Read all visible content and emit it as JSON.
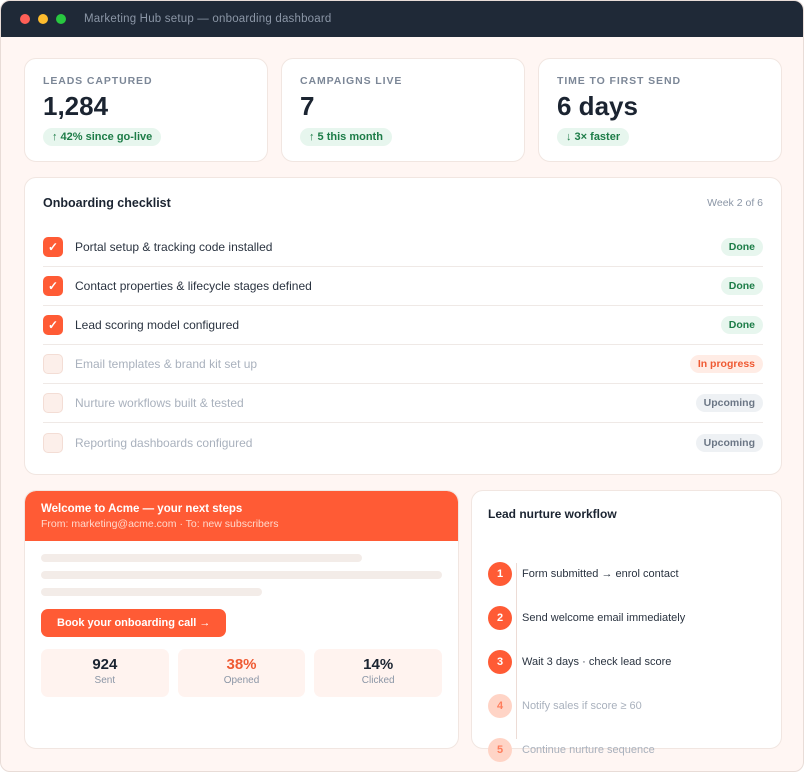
{
  "window": {
    "title": "Marketing Hub setup — onboarding dashboard"
  },
  "stats": [
    {
      "label": "LEADS CAPTURED",
      "value": "1,284",
      "delta": "↑ 42% since go-live"
    },
    {
      "label": "CAMPAIGNS LIVE",
      "value": "7",
      "delta": "↑ 5 this month"
    },
    {
      "label": "TIME TO FIRST SEND",
      "value": "6 days",
      "delta": "↓ 3× faster"
    }
  ],
  "checklist": {
    "title": "Onboarding checklist",
    "week": "Week 2 of 6",
    "items": [
      {
        "label": "Portal setup & tracking code installed",
        "status": "Done",
        "checked": true
      },
      {
        "label": "Contact properties & lifecycle stages defined",
        "status": "Done",
        "checked": true
      },
      {
        "label": "Lead scoring model configured",
        "status": "Done",
        "checked": true
      },
      {
        "label": "Email templates & brand kit set up",
        "status": "In progress",
        "checked": false
      },
      {
        "label": "Nurture workflows built & tested",
        "status": "Upcoming",
        "checked": false
      },
      {
        "label": "Reporting dashboards configured",
        "status": "Upcoming",
        "checked": false
      }
    ]
  },
  "email": {
    "subject": "Welcome to Acme — your next steps",
    "from": "From: marketing@acme.com · To: new subscribers",
    "cta": "Book your onboarding call →",
    "metrics": [
      {
        "value": "924",
        "label": "Sent"
      },
      {
        "value": "38%",
        "label": "Opened"
      },
      {
        "value": "14%",
        "label": "Clicked"
      }
    ]
  },
  "workflow": {
    "title": "Lead nurture workflow",
    "steps": [
      {
        "num": "1",
        "label": "Form submitted → enrol contact"
      },
      {
        "num": "2",
        "label": "Send welcome email immediately"
      },
      {
        "num": "3",
        "label": "Wait 3 days · check lead score"
      },
      {
        "num": "4",
        "label": "Notify sales if score ≥ 60"
      },
      {
        "num": "5",
        "label": "Continue nurture sequence"
      }
    ]
  },
  "colors": {
    "accent": "#ff5b35",
    "done": "#1c7c47",
    "titlebar": "#1f2937"
  }
}
